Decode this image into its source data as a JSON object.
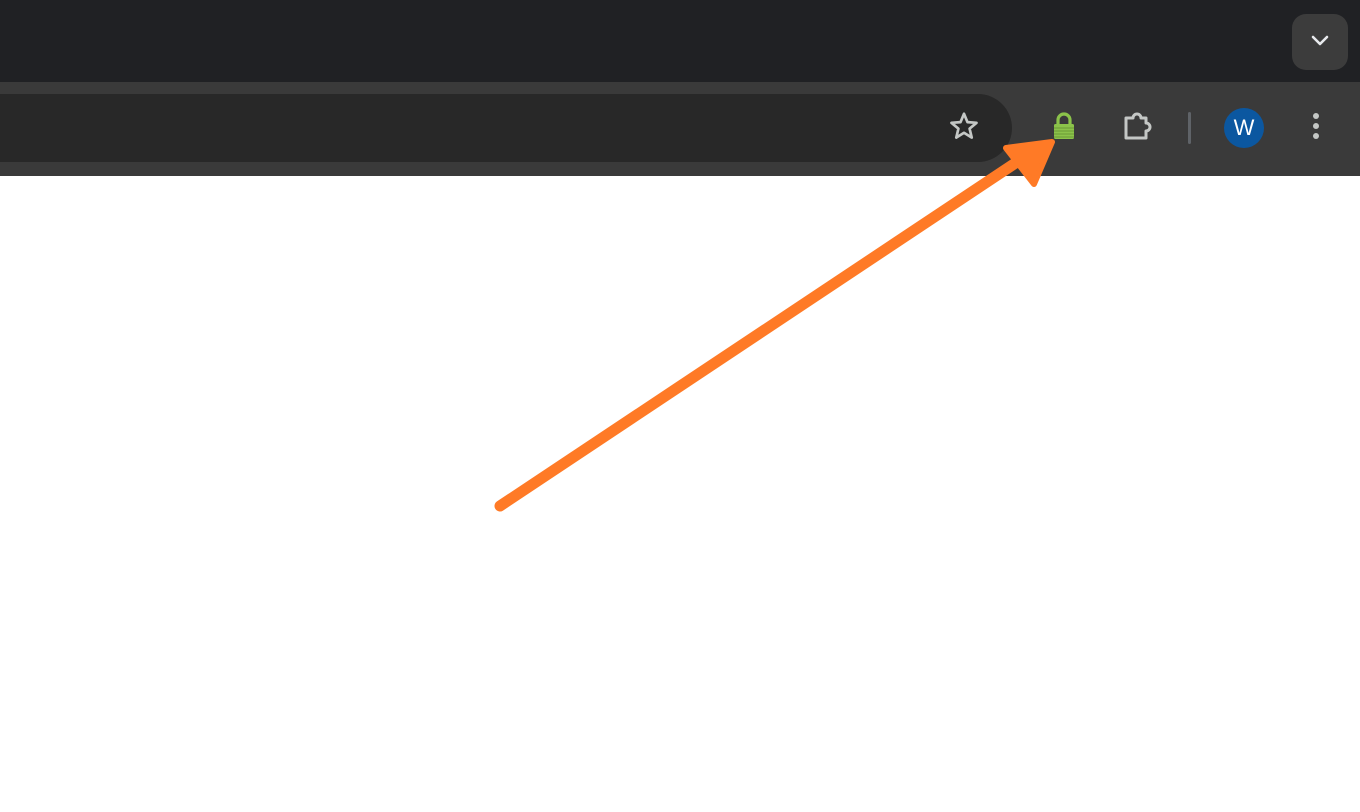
{
  "colors": {
    "tabstrip_bg": "#202124",
    "toolbar_bg": "#3a3a3a",
    "omnibox_bg": "#282828",
    "icon_color": "#c4c7c5",
    "lock_icon_color": "#8bc34a",
    "avatar_bg": "#0b57a0",
    "annotation_arrow": "#ff7a26",
    "page_bg": "#ffffff"
  },
  "tabstrip": {
    "tab_search_icon": "chevron-down-icon"
  },
  "toolbar": {
    "omnibox_bookmark_icon": "star-icon",
    "extensions": [
      {
        "icon": "lock-icon"
      },
      {
        "icon": "puzzle-piece-icon"
      }
    ],
    "profile": {
      "initial": "W"
    },
    "menu_icon": "three-dot-vertical-icon"
  },
  "annotation": {
    "type": "arrow",
    "points_to": "lock-icon"
  }
}
